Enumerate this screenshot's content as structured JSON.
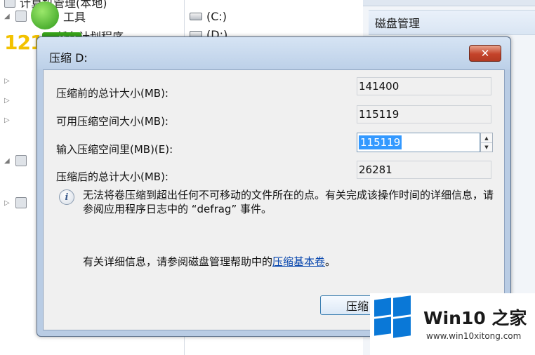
{
  "background": {
    "tree_items": [
      "计算机管理(本地)",
      "工具",
      "任务计划程序"
    ],
    "drives": [
      "(C:)",
      "(D:)"
    ],
    "actions_item": "磁盘管理",
    "logo_text": "121",
    "logo_badge": "下载站"
  },
  "dialog": {
    "title": "压缩 D:",
    "close_symbol": "✕",
    "fields": [
      {
        "label": "压缩前的总计大小(MB):",
        "value": "141400"
      },
      {
        "label": "可用压缩空间大小(MB):",
        "value": "115119"
      },
      {
        "label": "输入压缩空间里(MB)(E):",
        "value": "115119"
      },
      {
        "label": "压缩后的总计大小(MB):",
        "value": "26281"
      }
    ],
    "info_text": "无法将卷压缩到超出任何不可移动的文件所在的点。有关完成该操作时间的详细信息，请参阅应用程序日志中的 “defrag” 事件。",
    "help_prefix": "有关详细信息，请参阅磁盘管理帮助中的",
    "help_link": "压缩基本卷",
    "help_suffix": "。",
    "shrink_button": "压缩"
  },
  "watermark": {
    "brand": "Win10 之家",
    "url": "www.win10xitong.com"
  },
  "colors": {
    "selection": "#3399ff",
    "link": "#0645ad",
    "close_button": "#c4432a",
    "windows_blue": "#0a78d7"
  }
}
